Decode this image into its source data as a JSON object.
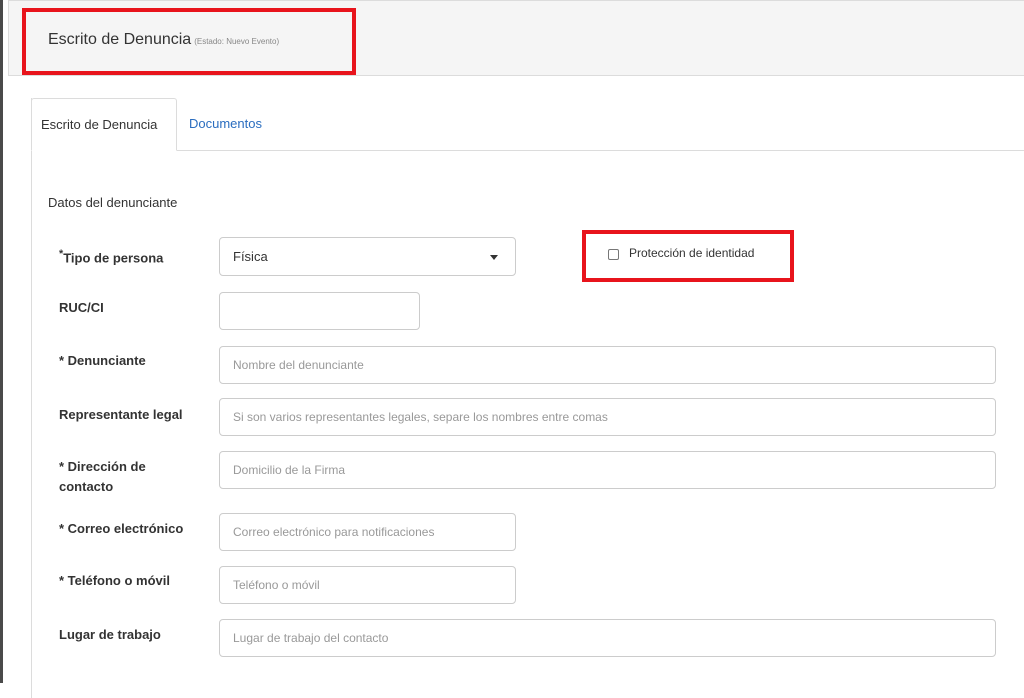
{
  "header": {
    "title": "Escrito de Denuncia",
    "status": "(Estado: Nuevo Evento)"
  },
  "tabs": [
    {
      "label": "Escrito de Denuncia",
      "active": true
    },
    {
      "label": "Documentos",
      "active": false
    }
  ],
  "colors": {
    "highlight": "#e8141c",
    "link": "#2a6dbf"
  },
  "form": {
    "section_title": "Datos del denunciante",
    "tipo_persona": {
      "required_mark": "*",
      "label": "Tipo de persona",
      "value": "Física"
    },
    "proteccion": {
      "label": "Protección de identidad",
      "checked": false
    },
    "ruc": {
      "label": "RUC/CI",
      "value": "",
      "placeholder": ""
    },
    "denunciante": {
      "required_mark": "* ",
      "label": "Denunciante",
      "placeholder": "Nombre del denunciante"
    },
    "representante": {
      "label": "Representante legal",
      "placeholder": "Si son varios representantes legales, separe los nombres entre comas"
    },
    "direccion": {
      "required_mark": "* ",
      "label": "Dirección de contacto",
      "placeholder": "Domicilio de la Firma"
    },
    "correo": {
      "required_mark": "* ",
      "label": "Correo electrónico",
      "placeholder": "Correo electrónico para notificaciones"
    },
    "telefono": {
      "required_mark": "* ",
      "label": "Teléfono o móvil",
      "placeholder": "Teléfono o móvil"
    },
    "lugar": {
      "label": "Lugar de trabajo",
      "placeholder": "Lugar de trabajo del contacto"
    }
  }
}
